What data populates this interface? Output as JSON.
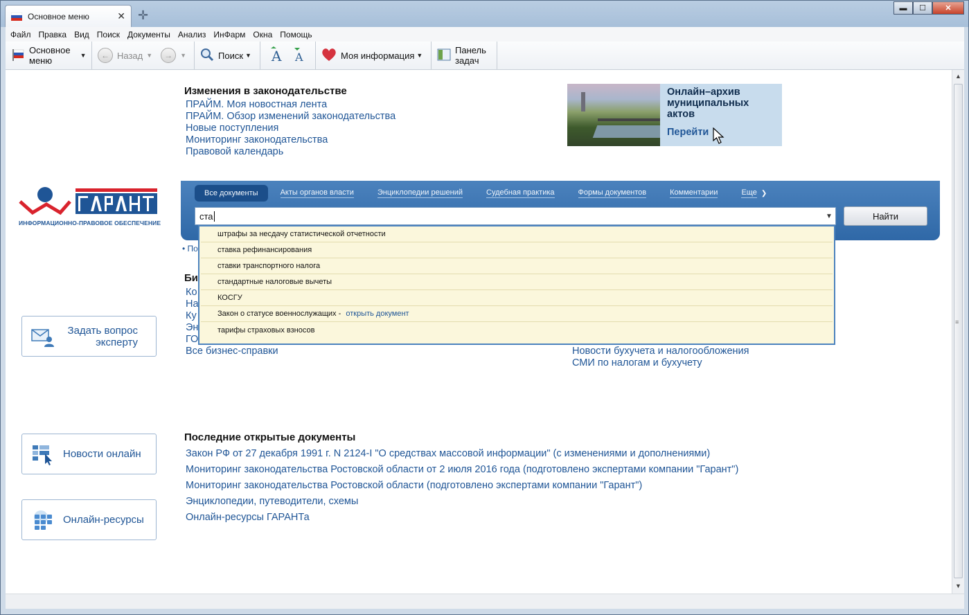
{
  "window": {
    "tab_title": "Основное меню",
    "close_tab": "✕",
    "new_tab": "✛",
    "minimize": "▬",
    "maximize": "☐",
    "close": "✕"
  },
  "menu": [
    "Файл",
    "Правка",
    "Вид",
    "Поиск",
    "Документы",
    "Анализ",
    "ИнФарм",
    "Окна",
    "Помощь"
  ],
  "toolbar": {
    "main_menu_line1": "Основное",
    "main_menu_line2": "меню",
    "back": "Назад",
    "search": "Поиск",
    "my_info": "Моя информация",
    "taskpanel_line1": "Панель",
    "taskpanel_line2": "задач"
  },
  "changes": {
    "title": "Изменения в законодательстве",
    "links": [
      "ПРАЙМ. Моя новостная лента",
      "ПРАЙМ. Обзор изменений законодательства",
      "Новые поступления",
      "Мониторинг законодательства",
      "Правовой календарь"
    ]
  },
  "promo": {
    "title_line1": "Онлайн–архив",
    "title_line2": "муниципальных",
    "title_line3": "актов",
    "go": "Перейти"
  },
  "logo": {
    "tagline": "ИНФОРМАЦИОННО-ПРАВОВОЕ ОБЕСПЕЧЕНИЕ",
    "colors": {
      "red": "#d9232d",
      "blue": "#1f5596"
    }
  },
  "search": {
    "tabs": [
      "Все документы",
      "Акты органов власти",
      "Энциклопедии решений",
      "Судебная практика",
      "Формы документов",
      "Комментарии",
      "Еще"
    ],
    "query": "ста",
    "button": "Найти",
    "suggestions": [
      "штрафы за несдачу статистической отчетности",
      "ставка рефинансирования",
      "ставки транспортного налога",
      "стандартные налоговые вычеты",
      "КОСГУ",
      "Закон о статусе военнослужащих - ",
      "тарифы страховых взносов"
    ],
    "open_doc": "открыть документ"
  },
  "hidden": {
    "po": "• По",
    "biz_label": "Би",
    "biz_partials": [
      "Ко",
      "На",
      "Ку",
      "Эн",
      "ГО"
    ],
    "biz_all": "Все бизнес-справки",
    "right_links": [
      "Новости бухучета и налогообложения",
      "СМИ по налогам и бухучету"
    ]
  },
  "left_buttons": {
    "ask_line1": "Задать вопрос",
    "ask_line2": "эксперту",
    "news": "Новости онлайн",
    "resources": "Онлайн-ресурсы"
  },
  "recent": {
    "title": "Последние открытые документы",
    "links": [
      "Закон РФ от 27 декабря 1991 г. N 2124-I \"О средствах массовой информации\" (с изменениями и дополнениями)",
      "Мониторинг законодательства Ростовской области от 2 июля 2016 года (подготовлено экспертами компании \"Гарант\")",
      "Мониторинг законодательства Ростовской области (подготовлено экспертами компании \"Гарант\")",
      "Энциклопедии, путеводители, схемы",
      "Онлайн-ресурсы ГАРАНТа"
    ]
  }
}
